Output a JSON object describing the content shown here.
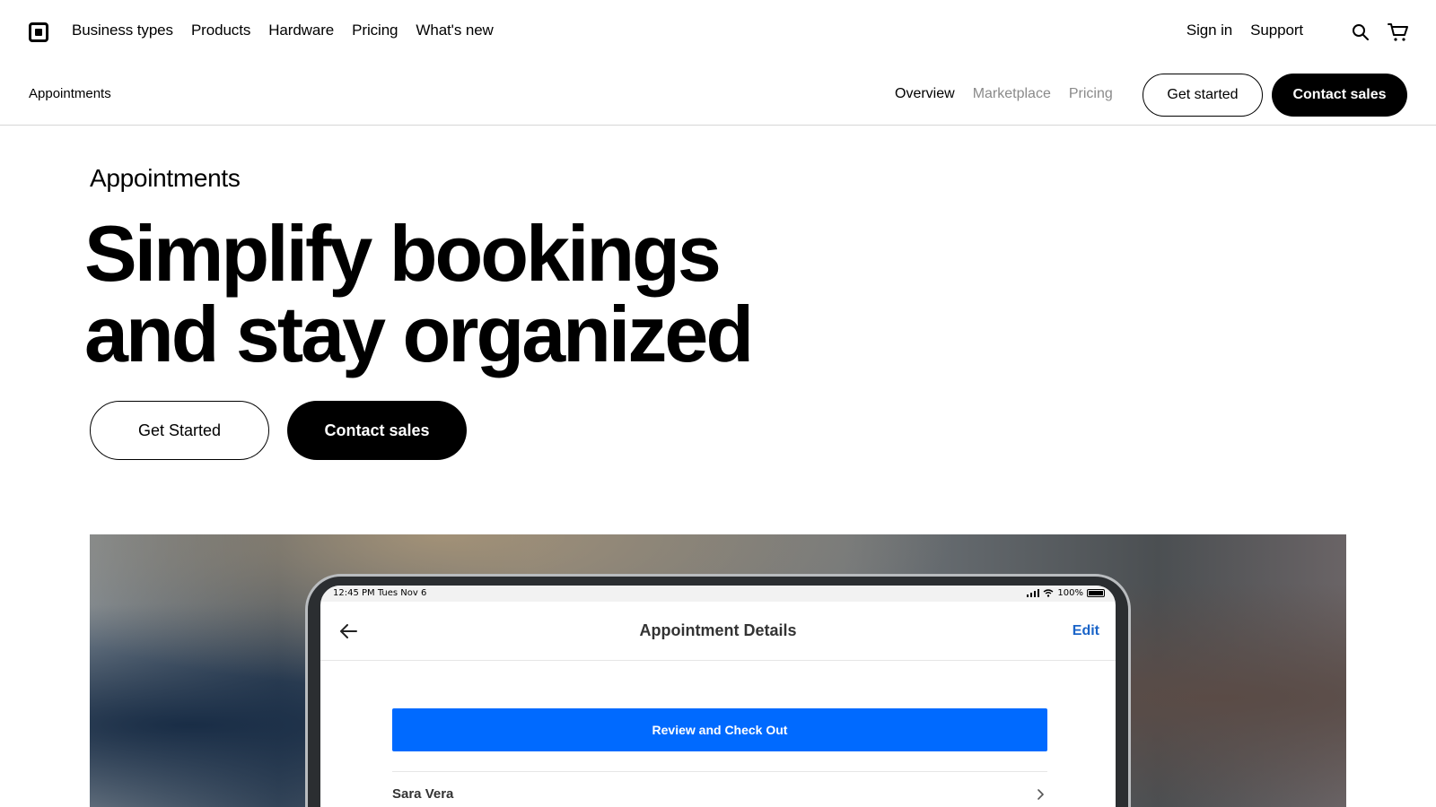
{
  "topnav": {
    "left_links": [
      "Business types",
      "Products",
      "Hardware",
      "Pricing",
      "What's new"
    ],
    "right_links": [
      "Sign in",
      "Support"
    ],
    "icons": [
      "square-logo-icon",
      "search-icon",
      "cart-icon"
    ]
  },
  "subnav": {
    "product_name": "Appointments",
    "links": [
      {
        "label": "Overview",
        "state": "active"
      },
      {
        "label": "Marketplace",
        "state": "muted"
      },
      {
        "label": "Pricing",
        "state": "muted"
      }
    ],
    "get_started_label": "Get started",
    "contact_sales_label": "Contact sales"
  },
  "hero": {
    "eyebrow": "Appointments",
    "headline_line1": "Simplify bookings",
    "headline_line2": "and stay organized",
    "cta_primary": "Get Started",
    "cta_secondary": "Contact sales"
  },
  "device": {
    "status_time": "12:45 PM   Tues Nov 6",
    "status_battery": "100%",
    "app_title": "Appointment Details",
    "edit_label": "Edit",
    "review_button": "Review and Check Out",
    "client_name": "Sara Vera",
    "accent_blue": "#006aff",
    "link_blue": "#1a64c8"
  }
}
